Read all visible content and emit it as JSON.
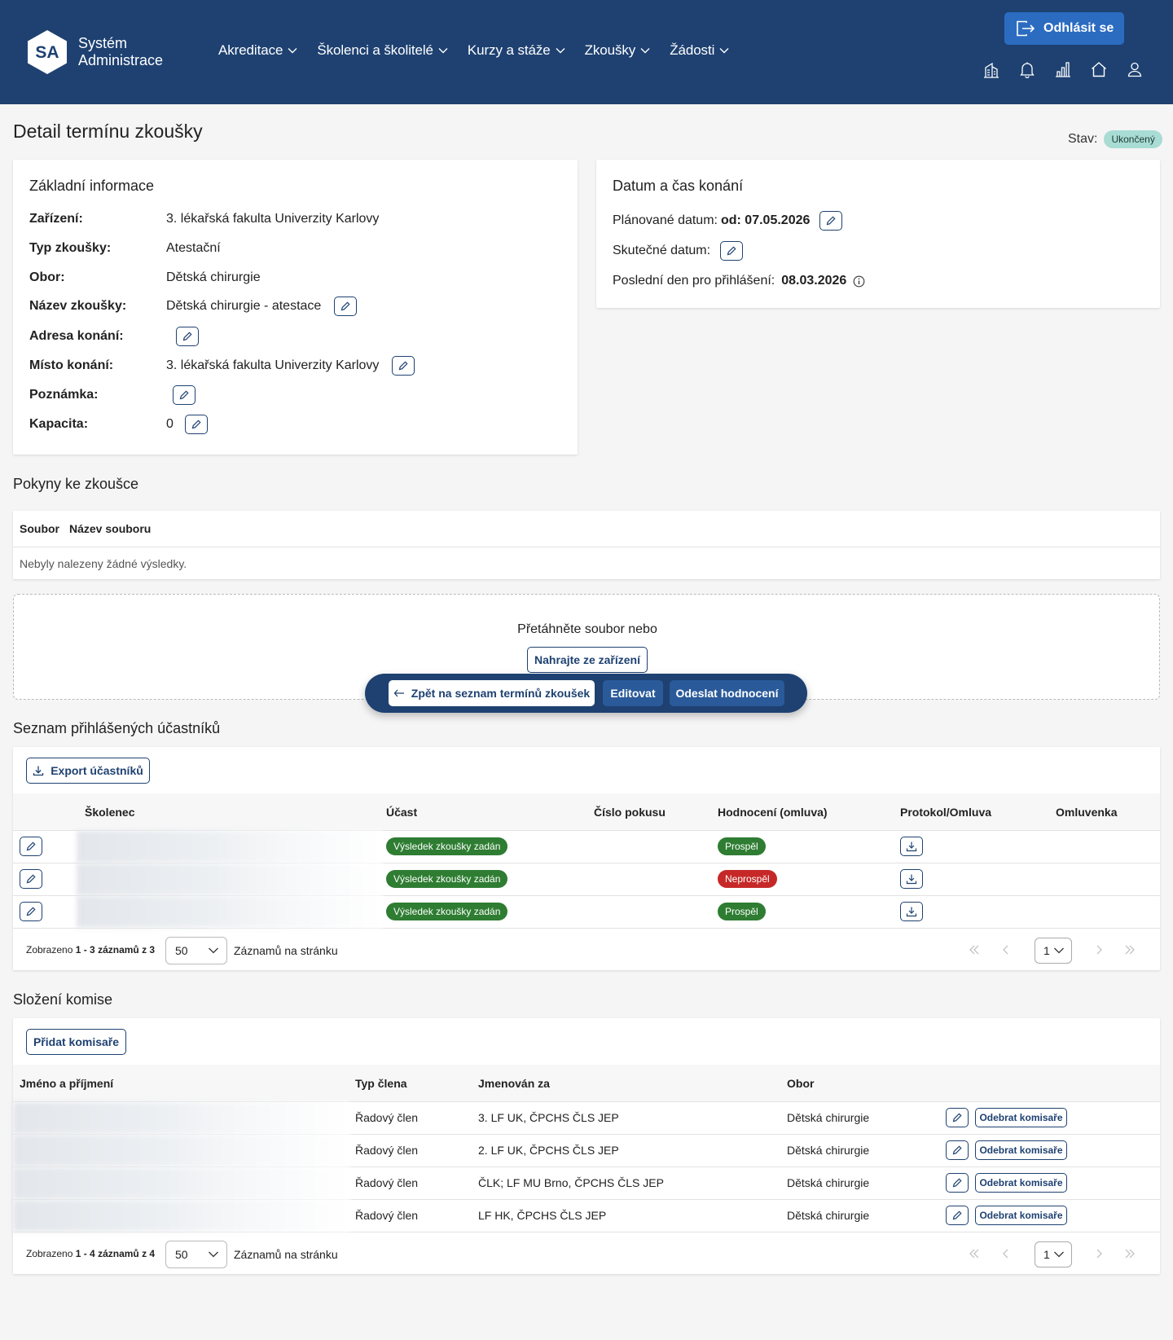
{
  "brand": {
    "logo": "SA",
    "line1": "Systém",
    "line2": "Administrace"
  },
  "nav": [
    "Akreditace",
    "Školenci a školitelé",
    "Kurzy a stáže",
    "Zkoušky",
    "Žádosti"
  ],
  "logout_label": "Odhlásit se",
  "top_icons": [
    "building-icon",
    "bell-icon",
    "bar-chart-icon",
    "home-icon",
    "user-icon"
  ],
  "page": {
    "title": "Detail termínu zkoušky",
    "status_label": "Stav:",
    "status_value": "Ukončený"
  },
  "basic_info": {
    "title": "Základní informace",
    "rows": [
      {
        "label": "Zařízení:",
        "value": "3. lékařská fakulta Univerzity Karlovy"
      },
      {
        "label": "Typ zkoušky:",
        "value": "Atestační"
      },
      {
        "label": "Obor:",
        "value": "Dětská chirurgie"
      },
      {
        "label": "Název zkoušky:",
        "value": "Dětská chirurgie - atestace"
      },
      {
        "label": "Adresa konání:",
        "value": ""
      },
      {
        "label": "Místo konání:",
        "value": "3. lékařská fakulta Univerzity Karlovy"
      },
      {
        "label": "Poznámka:",
        "value": ""
      },
      {
        "label": "Kapacita:",
        "value": "0"
      }
    ]
  },
  "datetime": {
    "title": "Datum a čas konání",
    "planned_label": "Plánované datum:",
    "planned_value": "od: 07.05.2026",
    "actual_label": "Skutečné datum:",
    "last_day_label": "Poslední den pro přihlášení:",
    "last_day_value": "08.03.2026"
  },
  "instructions": {
    "title": "Pokyny ke zkoušce",
    "col_file": "Soubor",
    "col_filename": "Název souboru",
    "empty": "Nebyly nalezeny žádné výsledky.",
    "drop_text": "Přetáhněte soubor nebo",
    "upload_label": "Nahrajte ze zařízení"
  },
  "action_bar": {
    "back": "Zpět na seznam termínů zkoušek",
    "edit": "Editovat",
    "send": "Odeslat hodnocení"
  },
  "participants": {
    "title": "Seznam přihlášených účastníků",
    "export_label": "Export účastníků",
    "columns": [
      "Školenec",
      "Účast",
      "Číslo pokusu",
      "Hodnocení (omluva)",
      "Protokol/Omluva",
      "Omluvenka"
    ],
    "rows": [
      {
        "ucast": "Výsledek zkoušky zadán",
        "hodnoceni": "Prospěl",
        "status": "pass"
      },
      {
        "ucast": "Výsledek zkoušky zadán",
        "hodnoceni": "Neprospěl",
        "status": "fail"
      },
      {
        "ucast": "Výsledek zkoušky zadán",
        "hodnoceni": "Prospěl",
        "status": "pass"
      }
    ],
    "summary_prefix": "Zobrazeno",
    "summary_range": "1 - 3 záznamů z 3",
    "page_size": "50",
    "page_size_label": "Záznamů na stránku",
    "page": "1"
  },
  "committee": {
    "title": "Složení komise",
    "add_label": "Přidat komisaře",
    "columns": [
      "Jméno a příjmení",
      "Typ člena",
      "Jmenován za",
      "Obor"
    ],
    "rows": [
      {
        "typ": "Řadový člen",
        "jmenovan": "3. LF UK, ČPCHS ČLS JEP",
        "obor": "Dětská chirurgie"
      },
      {
        "typ": "Řadový člen",
        "jmenovan": "2. LF UK, ČPCHS ČLS JEP",
        "obor": "Dětská chirurgie"
      },
      {
        "typ": "Řadový člen",
        "jmenovan": "ČLK; LF MU Brno, ČPCHS ČLS JEP",
        "obor": "Dětská chirurgie"
      },
      {
        "typ": "Řadový člen",
        "jmenovan": "LF HK, ČPCHS ČLS JEP",
        "obor": "Dětská chirurgie"
      }
    ],
    "remove_label": "Odebrat komisaře",
    "summary_prefix": "Zobrazeno",
    "summary_range": "1 - 4 záznamů z 4",
    "page_size": "50",
    "page_size_label": "Záznamů na stránku",
    "page": "1"
  },
  "colors": {
    "navy": "#1e4171",
    "pass": "#2e7d32",
    "fail": "#c62828",
    "status": "#a8dcd4"
  }
}
